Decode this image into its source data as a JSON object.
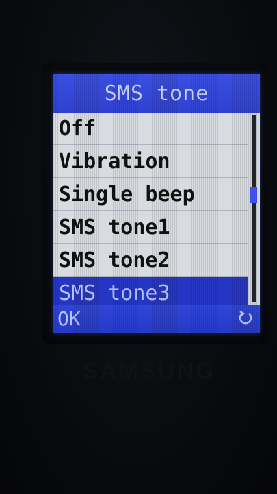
{
  "header": {
    "title": "SMS tone"
  },
  "menu": {
    "items": [
      {
        "label": "Off",
        "selected": false
      },
      {
        "label": "Vibration",
        "selected": false
      },
      {
        "label": "Single beep",
        "selected": false
      },
      {
        "label": "SMS tone1",
        "selected": false
      },
      {
        "label": "SMS tone2",
        "selected": false
      },
      {
        "label": "SMS tone3",
        "selected": true
      }
    ]
  },
  "softkeys": {
    "left": "OK",
    "right_icon": "back-icon"
  },
  "device": {
    "brand": "SAMSUNG"
  },
  "colors": {
    "title_bg": "#3a4fe0",
    "selected_bg": "#2636c4",
    "list_bg": "#d8dbe0",
    "softkey_bg": "#2639c6"
  }
}
